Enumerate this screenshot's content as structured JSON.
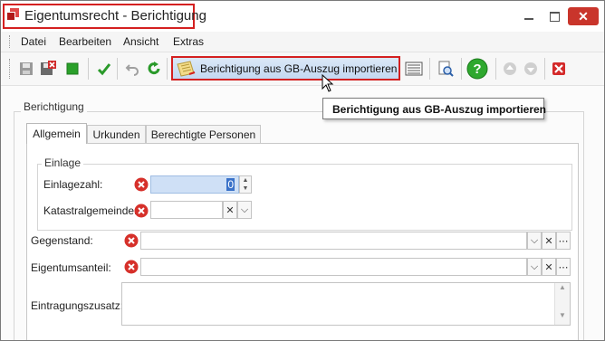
{
  "window": {
    "title": "Eigentumsrecht - Berichtigung"
  },
  "menu": {
    "items": [
      "Datei",
      "Bearbeiten",
      "Ansicht",
      "Extras"
    ]
  },
  "toolbar": {
    "import_button_label": "Berichtigung aus GB-Auszug importieren",
    "tooltip": "Berichtigung aus GB-Auszug importieren",
    "icons": [
      "save-icon",
      "save-close-icon",
      "stop-icon",
      "check-icon",
      "undo-icon",
      "refresh-icon",
      "import-icon",
      "grid-icon",
      "preview-icon",
      "help-icon",
      "up-icon",
      "down-icon",
      "delete-icon"
    ]
  },
  "form": {
    "group_title": "Berichtigung",
    "tabs": [
      "Allgemein",
      "Urkunden",
      "Berechtigte Personen"
    ],
    "active_tab": "Allgemein",
    "einlage": {
      "title": "Einlage",
      "einlagezahl_label": "Einlagezahl:",
      "einlagezahl_value": "0",
      "katastralgemeinde_label": "Katastralgemeinde:",
      "katastralgemeinde_value": ""
    },
    "gegenstand_label": "Gegenstand:",
    "gegenstand_value": "",
    "eigentumsanteil_label": "Eigentumsanteil:",
    "eigentumsanteil_value": "",
    "eintragungszusatz_label": "Eintragungszusatz:",
    "eintragungszusatz_value": ""
  },
  "colors": {
    "highlight_border": "#d42020",
    "error_icon": "#d6302a",
    "accent": "#3a72c9"
  }
}
